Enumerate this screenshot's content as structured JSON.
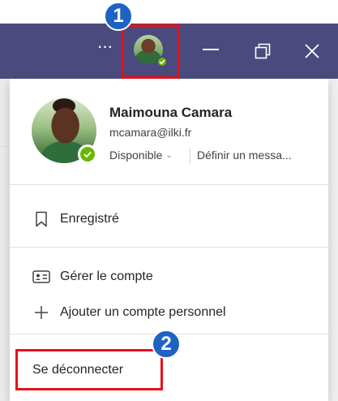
{
  "titlebar": {
    "more_label": "···",
    "icons": [
      "more-icon",
      "minimize-icon",
      "restore-icon",
      "close-icon"
    ]
  },
  "badges": {
    "first": "1",
    "second": "2"
  },
  "profile": {
    "name": "Maimouna Camara",
    "email": "mcamara@ilki.fr",
    "status": "Disponible",
    "set_message": "Définir un messa..."
  },
  "menu": {
    "saved": "Enregistré",
    "manage_account": "Gérer le compte",
    "add_personal": "Ajouter un compte personnel",
    "sign_out": "Se déconnecter"
  },
  "colors": {
    "titlebar": "#4b4a7e",
    "presence": "#6bb700",
    "badge": "#1e63c4",
    "highlight": "#e8111a"
  }
}
